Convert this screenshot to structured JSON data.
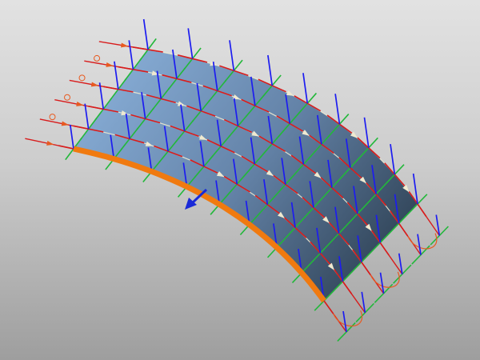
{
  "viewport": {
    "background_top": "#e2e2e2",
    "background_bottom": "#9e9e9e"
  },
  "surface": {
    "name": "curved-surface-patch",
    "color_light": "#8fb6e0",
    "color_dark": "#2f4255",
    "grid_rows": 5,
    "grid_cols": 8
  },
  "frames": {
    "normal_color": "#1c1cf0",
    "tangent_u_color": "#d81c1c",
    "tangent_v_color": "#22b83a",
    "curve_color": "#f0ead0",
    "arrow_color": "#e85a20"
  },
  "boundary_edge": {
    "color": "#f07a10"
  },
  "indicator_arrow": {
    "color": "#1a2ad8",
    "icon": "blue-direction-arrow"
  }
}
